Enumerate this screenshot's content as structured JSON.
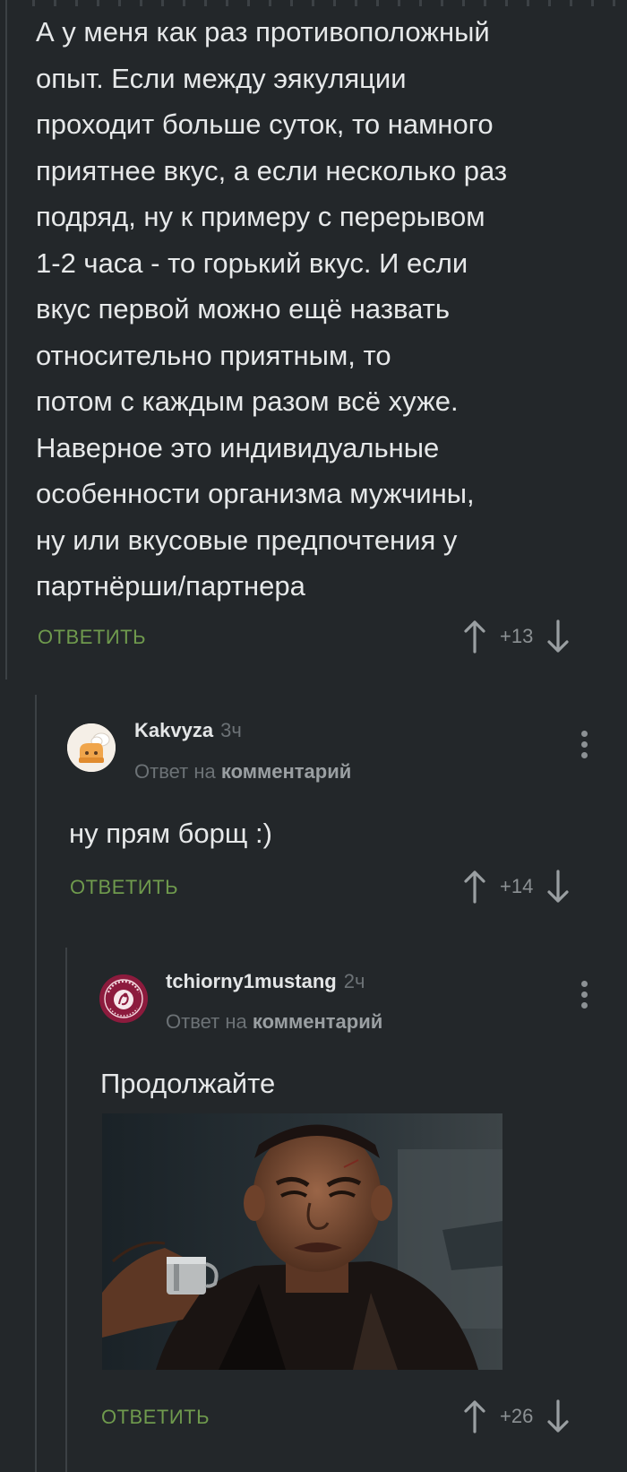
{
  "thread": {
    "parent": {
      "body_lines": [
        "А у меня как раз противоположный",
        "опыт. Если между эякуляции",
        "проходит больше суток, то намного",
        "приятнее вкус, а если несколько раз",
        "подряд, ну к примеру с перерывом",
        "1-2 часа - то горький вкус. И если",
        "вкус первой можно ещё назвать",
        "относительно приятным, то",
        "потом с каждым разом всё хуже.",
        "Наверное это индивидуальные",
        "особенности организма мужчины,",
        "ну или вкусовые предпочтения у",
        "партнёрши/партнера"
      ],
      "reply_label": "ОТВЕТИТЬ",
      "score": "+13"
    },
    "reply1": {
      "author": "Kakvyza",
      "time": "3ч",
      "reply_prefix": "Ответ на",
      "reply_link": "комментарий",
      "body": "ну прям борщ :)",
      "reply_label": "ОТВЕТИТЬ",
      "score": "+14"
    },
    "reply2": {
      "author": "tchiorny1mustang",
      "time": "2ч",
      "reply_prefix": "Ответ на",
      "reply_link": "комментарий",
      "body": "Продолжайте",
      "reply_label": "ОТВЕТИТЬ",
      "score": "+26"
    }
  },
  "colors": {
    "background": "#23272a",
    "reply_green": "#6f9a4d",
    "muted": "#6c7276",
    "text": "#e6e8e9",
    "thread_line": "#3c4145"
  },
  "icons": [
    "upvote-icon",
    "downvote-icon",
    "more-options-icon"
  ]
}
